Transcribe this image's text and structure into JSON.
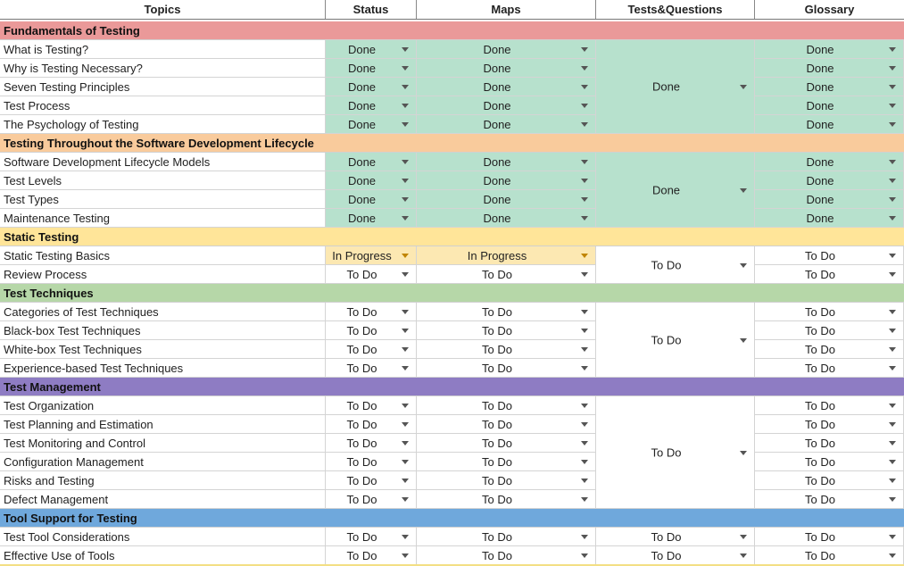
{
  "headers": [
    "Topics",
    "Status",
    "Maps",
    "Tests&Questions",
    "Glossary"
  ],
  "colors": {
    "done": "#b7e1cd",
    "in_progress": "#fce8b2",
    "section_fundamentals": "#ea9999",
    "section_lifecycle": "#f9cb9c",
    "section_static": "#ffe599",
    "section_techniques": "#b6d7a8",
    "section_management": "#8e7cc3",
    "section_tools": "#6fa8dc"
  },
  "sections": [
    {
      "title": "Fundamentals of Testing",
      "color": "#ea9999",
      "tests": "Done",
      "topics": [
        {
          "topic": "What is Testing?",
          "status": "Done",
          "maps": "Done",
          "glossary": "Done"
        },
        {
          "topic": "Why is Testing Necessary?",
          "status": "Done",
          "maps": "Done",
          "glossary": "Done"
        },
        {
          "topic": "Seven Testing Principles",
          "status": "Done",
          "maps": "Done",
          "glossary": "Done"
        },
        {
          "topic": "Test Process",
          "status": "Done",
          "maps": "Done",
          "glossary": "Done"
        },
        {
          "topic": "The Psychology of Testing",
          "status": "Done",
          "maps": "Done",
          "glossary": "Done"
        }
      ]
    },
    {
      "title": "Testing Throughout the Software Development Lifecycle",
      "color": "#f9cb9c",
      "tests": "Done",
      "topics": [
        {
          "topic": "Software Development Lifecycle Models",
          "status": "Done",
          "maps": "Done",
          "glossary": "Done"
        },
        {
          "topic": "Test Levels",
          "status": "Done",
          "maps": "Done",
          "glossary": "Done"
        },
        {
          "topic": "Test Types",
          "status": "Done",
          "maps": "Done",
          "glossary": "Done"
        },
        {
          "topic": "Maintenance Testing",
          "status": "Done",
          "maps": "Done",
          "glossary": "Done"
        }
      ]
    },
    {
      "title": "Static Testing",
      "color": "#ffe599",
      "tests": "To Do",
      "topics": [
        {
          "topic": "Static Testing Basics",
          "status": "In Progress",
          "maps": "In Progress",
          "glossary": "To Do"
        },
        {
          "topic": "Review Process",
          "status": "To Do",
          "maps": "To Do",
          "glossary": "To Do"
        }
      ]
    },
    {
      "title": "Test Techniques",
      "color": "#b6d7a8",
      "tests": "To Do",
      "topics": [
        {
          "topic": "Categories of Test Techniques",
          "status": "To Do",
          "maps": "To Do",
          "glossary": "To Do"
        },
        {
          "topic": "Black-box Test Techniques",
          "status": "To Do",
          "maps": "To Do",
          "glossary": "To Do"
        },
        {
          "topic": "White-box Test Techniques",
          "status": "To Do",
          "maps": "To Do",
          "glossary": "To Do"
        },
        {
          "topic": "Experience-based Test Techniques",
          "status": "To Do",
          "maps": "To Do",
          "glossary": "To Do"
        }
      ]
    },
    {
      "title": "Test Management",
      "color": "#8e7cc3",
      "tests": "To Do",
      "topics": [
        {
          "topic": "Test Organization",
          "status": "To Do",
          "maps": "To Do",
          "glossary": "To Do"
        },
        {
          "topic": "Test Planning and Estimation",
          "status": "To Do",
          "maps": "To Do",
          "glossary": "To Do"
        },
        {
          "topic": "Test Monitoring and Control",
          "status": "To Do",
          "maps": "To Do",
          "glossary": "To Do"
        },
        {
          "topic": "Configuration Management",
          "status": "To Do",
          "maps": "To Do",
          "glossary": "To Do"
        },
        {
          "topic": "Risks and Testing",
          "status": "To Do",
          "maps": "To Do",
          "glossary": "To Do"
        },
        {
          "topic": "Defect Management",
          "status": "To Do",
          "maps": "To Do",
          "glossary": "To Do"
        }
      ]
    },
    {
      "title": "Tool Support for Testing",
      "color": "#6fa8dc",
      "tests": null,
      "topics": [
        {
          "topic": "Test Tool Considerations",
          "status": "To Do",
          "maps": "To Do",
          "tests": "To Do",
          "glossary": "To Do"
        },
        {
          "topic": "Effective Use of Tools",
          "status": "To Do",
          "maps": "To Do",
          "tests": "To Do",
          "glossary": "To Do"
        }
      ]
    }
  ]
}
